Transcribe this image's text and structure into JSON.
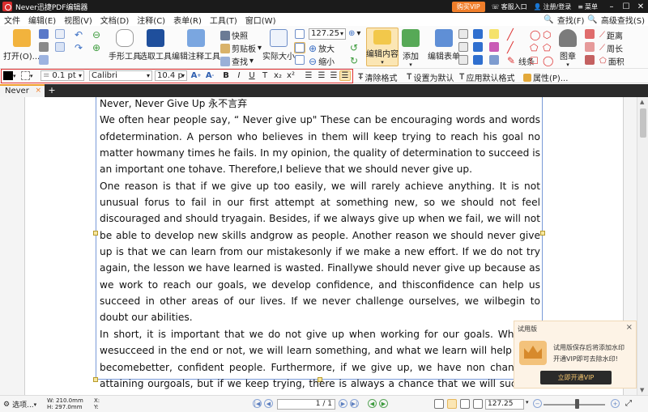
{
  "titlebar": {
    "title": "Never迅捷PDF编辑器",
    "vip_label": "购买VIP",
    "service_label": "客服入口",
    "account_label": "注册/登录",
    "menu_label": "菜单"
  },
  "menubar": {
    "items": [
      "文件",
      "编辑(E)",
      "视图(V)",
      "文档(D)",
      "注释(C)",
      "表单(R)",
      "工具(T)",
      "窗口(W)"
    ],
    "find_label": "查找(F)",
    "advanced_find_label": "高级查找(S)"
  },
  "ribbon": {
    "open_label": "打开(O)...",
    "hand_tool_label": "手形工具",
    "select_tool_label": "选取工具",
    "edit_tool_label": "编辑注释工具",
    "snapshot_label": "快照",
    "clipboard_label": "剪贴板",
    "find_label": "查找",
    "actual_size_label": "实际大小",
    "zoom_value": "127.25",
    "zoom_in_label": "放大",
    "zoom_out_label": "缩小",
    "edit_content_label": "编辑内容",
    "add_label": "添加",
    "edit_form_label": "编辑表单",
    "lines_label": "线条",
    "stamp_label": "图章",
    "distance_label": "距离",
    "perimeter_label": "周长",
    "area_label": "面积"
  },
  "formatbar": {
    "stroke_width": "0.1 pt",
    "font_name": "Calibri",
    "font_size": "10.4 p",
    "bold": "B",
    "italic": "I",
    "underline": "U",
    "strike": "T",
    "subscript": "x₂",
    "superscript": "x²",
    "clear_format_label": "清除格式",
    "set_default_label": "设置为默认",
    "apply_default_label": "应用默认格式",
    "properties_label": "属性(P)..."
  },
  "tabs": [
    {
      "label": "Never"
    }
  ],
  "document": {
    "heading": "Never, Never Give Up  永不言弃",
    "paragraphs": [
      "We often hear people say,  “ Never give up\" These can be encouraging words and words ofdetermination. A person who believes in them will keep trying to reach his goal no matter howmany times he fails. In my opinion, the quality of determination to succeed is an important one tohave. Therefore,I believe that we should never give up.",
      "One reason is that if we give up too easily, we will rarely achieve anything. It is not unusual forus to fail in our first attempt at something new, so we should not feel discouraged and should tryagain. Besides, if we always give up when we fail, we will not be able to develop new skills andgrow as people. Another reason we should never give up is that we can learn from our mistakesonly if we make a new effort. If we do not try again, the lesson we have learned is wasted. Finallywe should never give up because as we work to reach our goals, we develop confidence, and thisconfidence can help us succeed in other areas of our lives. If we never challenge ourselves, we wilbegin to doubt our abilities.",
      "In short, it is important that we do not give up when working for our goals. Whether wesucceed in the end or not, we will learn something, and what we learn will help us to becomebetter, confident people. Furthermore, if we give up, we have non chance of attaining ourgoals, but if we keep trying, there is always a chance that we will succeed one day."
    ]
  },
  "trial_panel": {
    "title": "试用版",
    "line1": "试用版保存后将添加水印",
    "line2": "开通VIP即可去除水印!",
    "button_label": "立即开通VIP"
  },
  "statusbar": {
    "options_label": "选项...",
    "width_label": "W: 210.0mm",
    "height_label": "H: 297.0mm",
    "x_label": "X:",
    "y_label": "Y:",
    "page_indicator": "1 / 1",
    "zoom_value": "127.25"
  }
}
